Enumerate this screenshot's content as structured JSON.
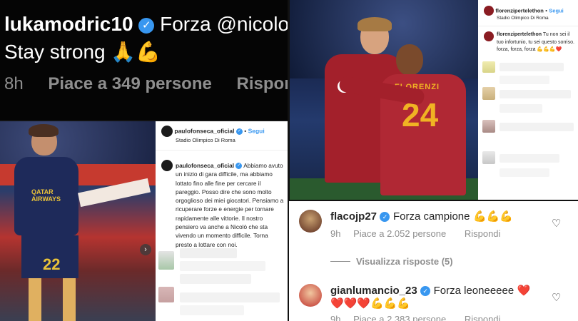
{
  "panel1": {
    "username": "lukamodric10",
    "comment_line1": "Forza @nicolo",
    "comment_line2": "Stay strong",
    "emojis": "🙏💪",
    "time": "8h",
    "likes": "Piace a 349 persone",
    "reply": "Rispondi"
  },
  "panel2": {
    "username": "paulofonseca_oficial",
    "follow": "Segui",
    "location": "Stadio Olimpico Di Roma",
    "caption_user": "paulofonseca_oficial",
    "caption": "Abbiamo avuto un inizio di gara difficile, ma abbiamo lottato fino alle fine per cercare il pareggio. Posso dire che sono molto orgoglioso dei miei giocatori. Pensiamo a ricuperare forze e energie per tornare rapidamente alle vittorie. Il nostro pensiero va anche a Nicolò che sta vivendo un momento difficile. Torna presto a lottare con noi.",
    "jersey_number": "22",
    "sponsor": "QATAR AIRWAYS"
  },
  "panel3": {
    "username": "florenzipertelethon",
    "follow": "Segui",
    "location": "Stadio Olimpico Di Roma",
    "caption_user": "florenzipertelethon",
    "caption": "Tu non sei il tuo infortunio, tu sei questo sorriso. forza, forza, forza 💪💪💪❤️",
    "shirt_text": "FLORENZI"
  },
  "panel4": {
    "comments": [
      {
        "user": "flacojp27",
        "text": "Forza campione",
        "emojis": "💪💪💪",
        "time": "9h",
        "likes": "Piace a 2.052 persone",
        "reply": "Rispondi"
      },
      {
        "user": "gianlumancio_23",
        "text": "Forza leoneeeee",
        "emojis": "❤️",
        "emojis_line2": "❤️❤️❤️💪💪💪",
        "time": "9h",
        "likes": "Piace a 2.383 persone",
        "reply": "Rispondi"
      }
    ],
    "view_replies": "Visualizza risposte (5)"
  },
  "colors": {
    "verified": "#3897f0",
    "roma_red": "#a3202b",
    "roma_gold": "#f0b323",
    "navy": "#1e2a5a"
  },
  "icons": [
    "verified-badge-icon",
    "heart-icon",
    "chevron-right-icon"
  ]
}
